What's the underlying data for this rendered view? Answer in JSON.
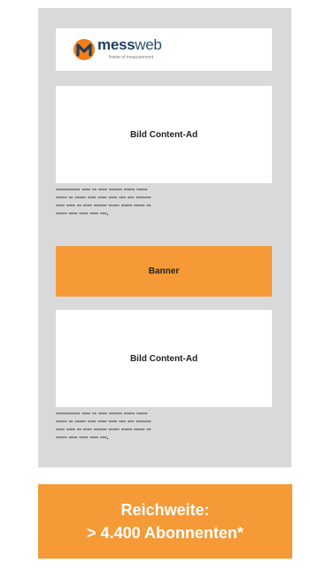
{
  "logo": {
    "brand_part1": "mess",
    "brand_part2": "web",
    "tagline": "frame of measurement",
    "icon": "messweb-m-logo-icon",
    "colors": {
      "orange": "#f07f1a",
      "navy": "#1f3f5f"
    }
  },
  "content_ad_1": {
    "label": "Bild Content-Ad"
  },
  "teaser_1": {
    "lines": [
      "----------- ---- -- ---- ------ ----- -----",
      "----- -- ----- ---- ---- ---- --- --- -------",
      "---- ---- -- ---- ------ ----- ----- ----- --",
      "----- ---- ---- ---- ---."
    ]
  },
  "banner": {
    "label": "Banner",
    "color": "#f59a36"
  },
  "content_ad_2": {
    "label": "Bild Content-Ad"
  },
  "teaser_2": {
    "lines": [
      "----------- ---- -- ---- ------ ----- -----",
      "----- -- ----- ---- ---- ---- --- --- -------",
      "---- ---- -- ---- ------ ----- ----- ----- --",
      "----- ---- ---- ---- ---."
    ]
  },
  "reach": {
    "line1": "Reichweite:",
    "line2": "> 4.400 Abonnenten*",
    "color": "#f59a36"
  }
}
